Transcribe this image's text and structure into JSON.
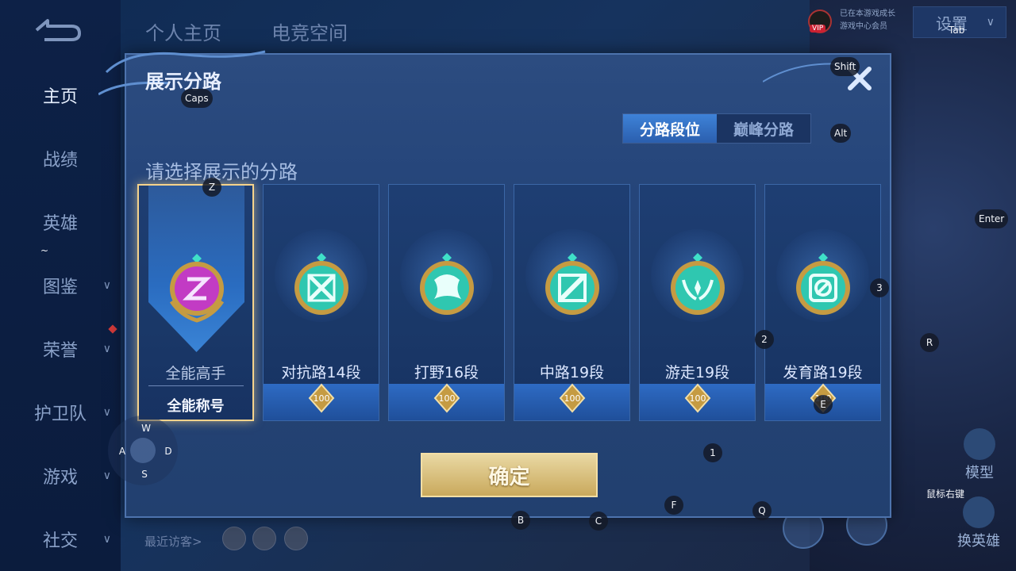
{
  "sidebar": {
    "items": [
      {
        "label": "主页",
        "active": true
      },
      {
        "label": "战绩",
        "active": false
      },
      {
        "label": "英雄",
        "active": false
      },
      {
        "label": "图鉴",
        "active": false
      },
      {
        "label": "荣誉",
        "active": false
      },
      {
        "label": "护卫队",
        "active": false
      },
      {
        "label": "游戏",
        "active": false
      },
      {
        "label": "社交",
        "active": false
      }
    ]
  },
  "top_nav": {
    "tabs": [
      "个人主页",
      "电竞空间"
    ],
    "vip_label": "VIP",
    "vip_text_1": "已在本游戏成长",
    "vip_text_2": "游戏中心会员",
    "settings_label": "设置"
  },
  "visitors_label": "最近访客>",
  "right_buttons": {
    "model": "模型",
    "change_hero": "换英雄"
  },
  "dialog": {
    "title": "展示分路",
    "segments": [
      "分路段位",
      "巅峰分路"
    ],
    "active_segment": 0,
    "prompt": "请选择展示的分路",
    "cards": [
      {
        "name": "全能高手",
        "title": "全能称号",
        "selected": true,
        "emblem": "all-round-emblem",
        "color": "#c23bc4"
      },
      {
        "name": "对抗路14段",
        "badge": "100",
        "selected": false,
        "emblem": "clash-lane-emblem",
        "color": "#2fc7b0"
      },
      {
        "name": "打野16段",
        "badge": "100",
        "selected": false,
        "emblem": "jungle-emblem",
        "color": "#2fc7b0"
      },
      {
        "name": "中路19段",
        "badge": "100",
        "selected": false,
        "emblem": "mid-lane-emblem",
        "color": "#2fc7b0"
      },
      {
        "name": "游走19段",
        "badge": "100",
        "selected": false,
        "emblem": "roam-emblem",
        "color": "#2fc7b0"
      },
      {
        "name": "发育路19段",
        "badge": "100",
        "selected": false,
        "emblem": "farm-lane-emblem",
        "color": "#2fc7b0"
      }
    ],
    "confirm_label": "确定"
  },
  "key_overlay": {
    "caps": "Caps",
    "shift": "Shift",
    "tab": "Tab",
    "alt": "Alt",
    "enter": "Enter",
    "z": "Z",
    "tilde": "~",
    "w": "W",
    "a": "A",
    "s": "S",
    "d": "D",
    "num3": "3",
    "num2": "2",
    "num1": "1",
    "r": "R",
    "e": "E",
    "f": "F",
    "q": "Q",
    "b": "B",
    "c": "C",
    "right_click": "鼠标右键"
  }
}
